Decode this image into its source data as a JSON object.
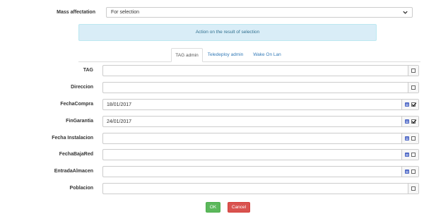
{
  "mass": {
    "label": "Mass affectation",
    "selected": "For selection"
  },
  "banner": {
    "text": "Action on the result of selection"
  },
  "tabs": [
    {
      "label": "TAG admin",
      "active": true
    },
    {
      "label": "Teledeploy admin",
      "active": false
    },
    {
      "label": "Wake On Lan",
      "active": false
    }
  ],
  "fields": [
    {
      "label": "TAG",
      "value": "",
      "calendar": false,
      "checked": false
    },
    {
      "label": "Direccion",
      "value": "",
      "calendar": false,
      "checked": false
    },
    {
      "label": "FechaCompra",
      "value": "18/01/2017",
      "calendar": true,
      "checked": true
    },
    {
      "label": "FinGarantia",
      "value": "24/01/2017",
      "calendar": true,
      "checked": true
    },
    {
      "label": "Fecha Instalacion",
      "value": "",
      "calendar": true,
      "checked": false
    },
    {
      "label": "FechaBajaRed",
      "value": "",
      "calendar": true,
      "checked": false
    },
    {
      "label": "EntradaAlmacen",
      "value": "",
      "calendar": true,
      "checked": false
    },
    {
      "label": "Poblacion",
      "value": "",
      "calendar": false,
      "checked": false
    }
  ],
  "buttons": {
    "ok": "OK",
    "cancel": "Cancel"
  },
  "colors": {
    "ok": "#5cb85c",
    "cancel": "#d9534f",
    "banner_bg": "#d9edf7",
    "link": "#337ab7",
    "calendar": "#4a64c4"
  }
}
